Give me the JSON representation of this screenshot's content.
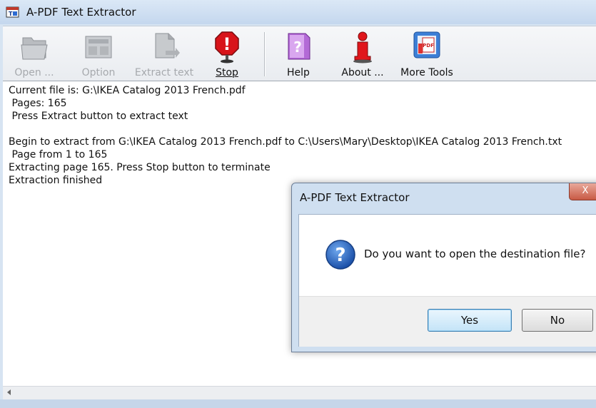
{
  "window": {
    "title": "A-PDF Text Extractor"
  },
  "toolbar": {
    "buttons": [
      {
        "label": "Open ...",
        "enabled": false,
        "icon": "folder-icon"
      },
      {
        "label": "Option",
        "enabled": false,
        "icon": "settings-icon"
      },
      {
        "label": "Extract text",
        "enabled": false,
        "icon": "extract-document-icon"
      },
      {
        "label": "Stop",
        "enabled": true,
        "icon": "stop-sign-icon"
      },
      {
        "label": "Help",
        "enabled": true,
        "icon": "help-book-icon"
      },
      {
        "label": "About ...",
        "enabled": true,
        "icon": "info-icon"
      },
      {
        "label": "More Tools",
        "enabled": true,
        "icon": "more-tools-icon"
      }
    ]
  },
  "log": {
    "lines": [
      "Current file is: G:\\IKEA Catalog 2013 French.pdf",
      " Pages: 165",
      " Press Extract button to extract text",
      "",
      "Begin to extract from G:\\IKEA Catalog 2013 French.pdf to C:\\Users\\Mary\\Desktop\\IKEA Catalog 2013 French.txt",
      " Page from 1 to 165",
      "Extracting page 165. Press Stop button to terminate",
      "Extraction finished"
    ]
  },
  "dialog": {
    "title": "A-PDF Text Extractor",
    "close_label": "X",
    "message": "Do you want to open the destination file?",
    "icon": "question-icon",
    "yes_label": "Yes",
    "no_label": "No"
  }
}
